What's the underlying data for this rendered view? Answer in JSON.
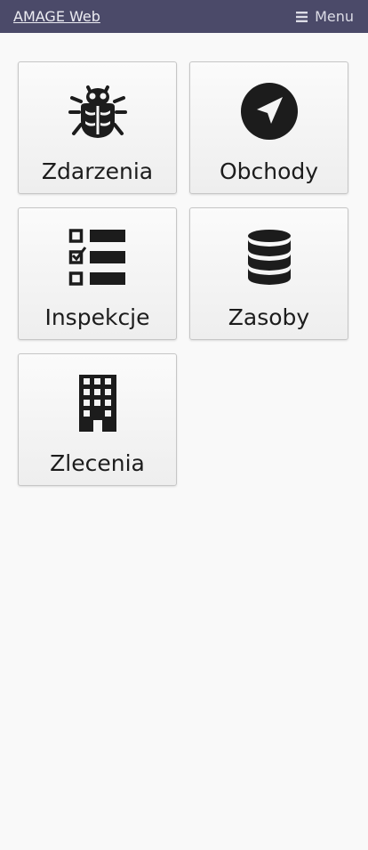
{
  "header": {
    "brand": "AMAGE Web",
    "menu_label": "Menu",
    "menu_icon": "bars-icon"
  },
  "tiles": [
    {
      "label": "Zdarzenia",
      "icon": "bug-icon"
    },
    {
      "label": "Obchody",
      "icon": "location-arrow-icon"
    },
    {
      "label": "Inspekcje",
      "icon": "checklist-icon"
    },
    {
      "label": "Zasoby",
      "icon": "database-icon"
    },
    {
      "label": "Zlecenia",
      "icon": "building-icon"
    }
  ],
  "colors": {
    "header_bg": "#4b4a69",
    "page_bg": "#f9f9f9",
    "icon": "#1c1c1c"
  }
}
